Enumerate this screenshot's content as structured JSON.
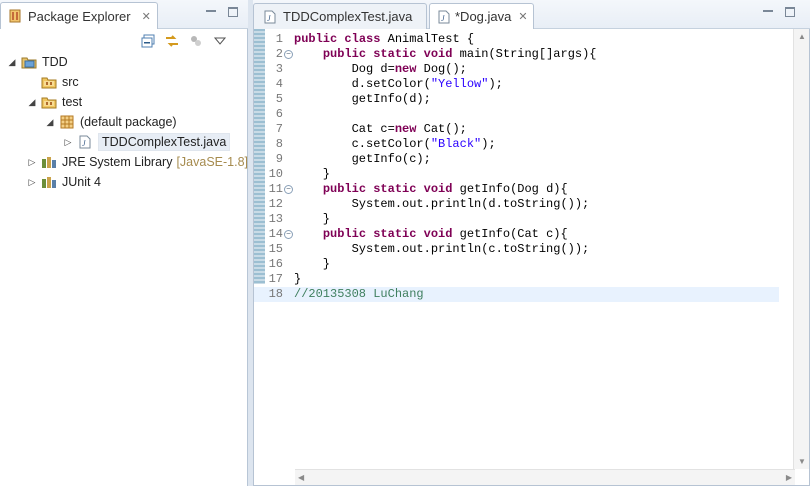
{
  "package_explorer": {
    "title": "Package Explorer",
    "close": "✕",
    "tree": [
      {
        "label": "TDD",
        "arrow": "◢",
        "icon": "java-project-icon"
      },
      {
        "label": "src",
        "arrow": "",
        "icon": "source-folder-icon"
      },
      {
        "label": "test",
        "arrow": "◢",
        "icon": "source-folder-icon"
      },
      {
        "label": "(default package)",
        "arrow": "◢",
        "icon": "package-icon"
      },
      {
        "label": "TDDComplexTest.java",
        "arrow": "▷",
        "icon": "java-file-icon"
      },
      {
        "label": "JRE System Library",
        "decoration": "[JavaSE-1.8]",
        "arrow": "▷",
        "icon": "library-icon"
      },
      {
        "label": "JUnit 4",
        "arrow": "▷",
        "icon": "library-icon"
      }
    ]
  },
  "editor": {
    "tabs": [
      {
        "label": "TDDComplexTest.java",
        "active": false
      },
      {
        "label": "*Dog.java",
        "active": true,
        "close": "✕"
      }
    ],
    "lines": [
      {
        "n": "1",
        "text": "public class AnimalTest {"
      },
      {
        "n": "2",
        "text": "    public static void main(String[]args){",
        "fold": "−"
      },
      {
        "n": "3",
        "text": "        Dog d=new Dog();"
      },
      {
        "n": "4",
        "text": "        d.setColor(\"Yellow\");"
      },
      {
        "n": "5",
        "text": "        getInfo(d);"
      },
      {
        "n": "6",
        "text": ""
      },
      {
        "n": "7",
        "text": "        Cat c=new Cat();"
      },
      {
        "n": "8",
        "text": "        c.setColor(\"Black\");"
      },
      {
        "n": "9",
        "text": "        getInfo(c);"
      },
      {
        "n": "10",
        "text": "    }"
      },
      {
        "n": "11",
        "text": "    public static void getInfo(Dog d){",
        "fold": "−"
      },
      {
        "n": "12",
        "text": "        System.out.println(d.toString());"
      },
      {
        "n": "13",
        "text": "    }"
      },
      {
        "n": "14",
        "text": "    public static void getInfo(Cat c){",
        "fold": "−"
      },
      {
        "n": "15",
        "text": "        System.out.println(c.toString());"
      },
      {
        "n": "16",
        "text": "    }"
      },
      {
        "n": "17",
        "text": "}"
      },
      {
        "n": "18",
        "text": "//20135308 LuChang",
        "current": true
      }
    ]
  },
  "colors": {
    "keyword": "#7f0055",
    "string": "#2a00ff",
    "comment": "#3f7f5f",
    "current_line": "#e8f2fe"
  }
}
